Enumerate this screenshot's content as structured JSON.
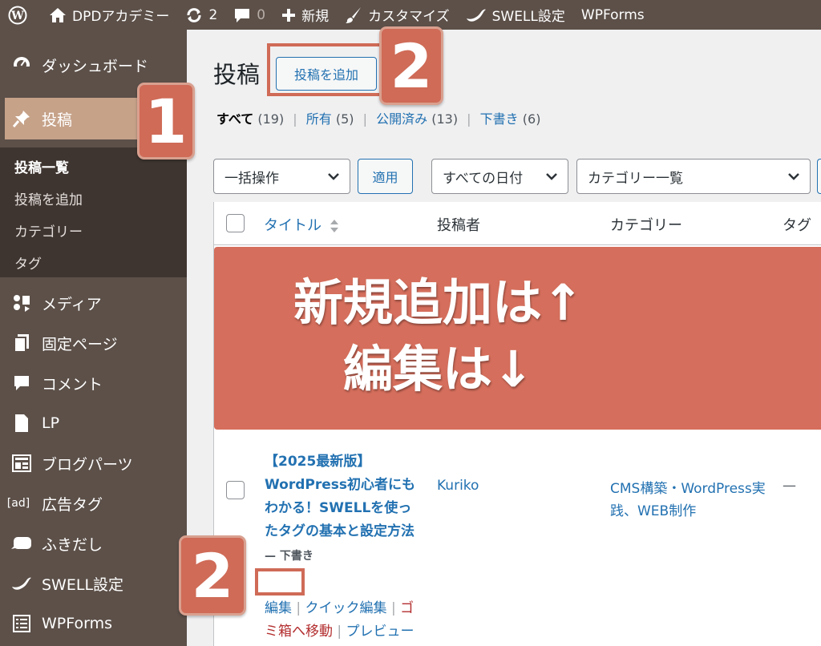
{
  "adminbar": {
    "site_name": "DPDアカデミー",
    "updates_count": "2",
    "comments_count": "0",
    "new_label": "新規",
    "customize_label": "カスタマイズ",
    "swell_label": "SWELL設定",
    "wpforms_label": "WPForms"
  },
  "sidebar": {
    "dashboard": "ダッシュボード",
    "posts": "投稿",
    "submenu": [
      "投稿一覧",
      "投稿を追加",
      "カテゴリー",
      "タグ"
    ],
    "media": "メディア",
    "pages": "固定ページ",
    "comments": "コメント",
    "lp": "LP",
    "blog_parts": "ブログパーツ",
    "ad_tag_icon_text": "[ad]",
    "ad_tags": "広告タグ",
    "balloon": "ふきだし",
    "swell_settings": "SWELL設定",
    "wpforms": "WPForms"
  },
  "main": {
    "title": "投稿",
    "add_new": "投稿を追加",
    "filters": {
      "all": "すべて",
      "all_count": "(19)",
      "mine": "所有",
      "mine_count": "(5)",
      "published": "公開済み",
      "published_count": "(13)",
      "drafts": "下書き",
      "drafts_count": "(6)"
    },
    "bulk_action": "一括操作",
    "apply": "適用",
    "date_filter": "すべての日付",
    "category_filter": "カテゴリー一覧"
  },
  "table": {
    "headers": {
      "title": "タイトル",
      "author": "投稿者",
      "category": "カテゴリー",
      "tags": "タグ"
    },
    "row": {
      "title": "【2025最新版】WordPress初心者にもわかる！SWELLを使ったタグの基本と設定方法",
      "state_sep": " — ",
      "state": "下書き",
      "author": "Kuriko",
      "categories": "CMS構築・WordPress実践、WEB制作",
      "tags": "—",
      "actions": {
        "edit": "編集",
        "sep": "|",
        "quick_edit": "クイック編集",
        "trash": "ゴミ箱へ移動",
        "preview": "プレビュー"
      }
    }
  },
  "annotations": {
    "badge1": "1",
    "badge2_top": "2",
    "badge2_bottom": "2",
    "banner_line1": "新規追加は↑",
    "banner_line2": "編集は↓",
    "color": "#cf6b57"
  }
}
